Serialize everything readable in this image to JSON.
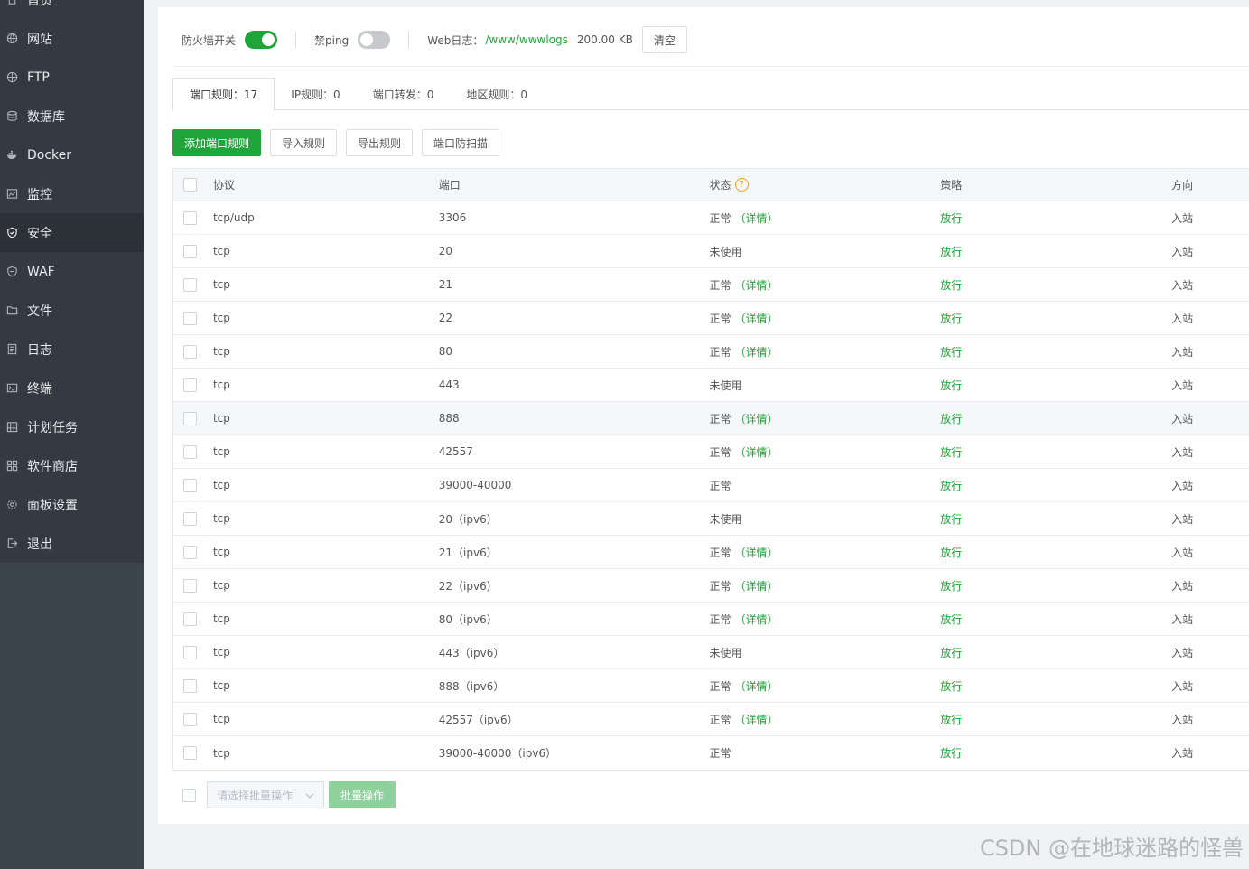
{
  "sidebar": {
    "items": [
      {
        "label": "首页",
        "icon": "home-icon",
        "active": false
      },
      {
        "label": "网站",
        "icon": "globe-icon",
        "active": false
      },
      {
        "label": "FTP",
        "icon": "ftp-icon",
        "active": false
      },
      {
        "label": "数据库",
        "icon": "database-icon",
        "active": false
      },
      {
        "label": "Docker",
        "icon": "docker-icon",
        "active": false
      },
      {
        "label": "监控",
        "icon": "monitor-icon",
        "active": false
      },
      {
        "label": "安全",
        "icon": "shield-check-icon",
        "active": true
      },
      {
        "label": "WAF",
        "icon": "waf-shield-icon",
        "active": false
      },
      {
        "label": "文件",
        "icon": "folder-icon",
        "active": false
      },
      {
        "label": "日志",
        "icon": "log-icon",
        "active": false
      },
      {
        "label": "终端",
        "icon": "terminal-icon",
        "active": false
      },
      {
        "label": "计划任务",
        "icon": "calendar-icon",
        "active": false
      },
      {
        "label": "软件商店",
        "icon": "grid-icon",
        "active": false
      },
      {
        "label": "面板设置",
        "icon": "gear-icon",
        "active": false
      },
      {
        "label": "退出",
        "icon": "logout-icon",
        "active": false
      }
    ]
  },
  "topbar": {
    "firewall_label": "防火墙开关",
    "firewall_on": true,
    "ping_label": "禁ping",
    "ping_on": false,
    "weblog_label": "Web日志：",
    "weblog_path": "/www/wwwlogs",
    "weblog_size": "200.00 KB",
    "clear_label": "清空"
  },
  "tabs": [
    {
      "label": "端口规则：17",
      "active": true
    },
    {
      "label": "IP规则：0",
      "active": false
    },
    {
      "label": "端口转发：0",
      "active": false
    },
    {
      "label": "地区规则：0",
      "active": false
    }
  ],
  "actions": {
    "add": "添加端口规则",
    "import": "导入规则",
    "export": "导出规则",
    "antiscan": "端口防扫描"
  },
  "table": {
    "headers": {
      "protocol": "协议",
      "port": "端口",
      "status": "状态",
      "policy": "策略",
      "direction": "方向"
    },
    "help_glyph": "?",
    "rows": [
      {
        "protocol": "tcp/udp",
        "port": "3306",
        "status": "正常",
        "detail": "（详情）",
        "policy": "放行",
        "direction": "入站"
      },
      {
        "protocol": "tcp",
        "port": "20",
        "status": "未使用",
        "detail": "",
        "policy": "放行",
        "direction": "入站"
      },
      {
        "protocol": "tcp",
        "port": "21",
        "status": "正常",
        "detail": "（详情）",
        "policy": "放行",
        "direction": "入站"
      },
      {
        "protocol": "tcp",
        "port": "22",
        "status": "正常",
        "detail": "（详情）",
        "policy": "放行",
        "direction": "入站"
      },
      {
        "protocol": "tcp",
        "port": "80",
        "status": "正常",
        "detail": "（详情）",
        "policy": "放行",
        "direction": "入站"
      },
      {
        "protocol": "tcp",
        "port": "443",
        "status": "未使用",
        "detail": "",
        "policy": "放行",
        "direction": "入站"
      },
      {
        "protocol": "tcp",
        "port": "888",
        "status": "正常",
        "detail": "（详情）",
        "policy": "放行",
        "direction": "入站"
      },
      {
        "protocol": "tcp",
        "port": "42557",
        "status": "正常",
        "detail": "（详情）",
        "policy": "放行",
        "direction": "入站"
      },
      {
        "protocol": "tcp",
        "port": "39000-40000",
        "status": "正常",
        "detail": "",
        "policy": "放行",
        "direction": "入站"
      },
      {
        "protocol": "tcp",
        "port": "20（ipv6）",
        "status": "未使用",
        "detail": "",
        "policy": "放行",
        "direction": "入站"
      },
      {
        "protocol": "tcp",
        "port": "21（ipv6）",
        "status": "正常",
        "detail": "（详情）",
        "policy": "放行",
        "direction": "入站"
      },
      {
        "protocol": "tcp",
        "port": "22（ipv6）",
        "status": "正常",
        "detail": "（详情）",
        "policy": "放行",
        "direction": "入站"
      },
      {
        "protocol": "tcp",
        "port": "80（ipv6）",
        "status": "正常",
        "detail": "（详情）",
        "policy": "放行",
        "direction": "入站"
      },
      {
        "protocol": "tcp",
        "port": "443（ipv6）",
        "status": "未使用",
        "detail": "",
        "policy": "放行",
        "direction": "入站"
      },
      {
        "protocol": "tcp",
        "port": "888（ipv6）",
        "status": "正常",
        "detail": "（详情）",
        "policy": "放行",
        "direction": "入站"
      },
      {
        "protocol": "tcp",
        "port": "42557（ipv6）",
        "status": "正常",
        "detail": "（详情）",
        "policy": "放行",
        "direction": "入站"
      },
      {
        "protocol": "tcp",
        "port": "39000-40000（ipv6）",
        "status": "正常",
        "detail": "",
        "policy": "放行",
        "direction": "入站"
      }
    ]
  },
  "batch": {
    "select_placeholder": "请选择批量操作",
    "button": "批量操作"
  },
  "watermark": "CSDN @在地球迷路的怪兽",
  "colors": {
    "accent": "#20a53a",
    "sidebar_bg": "#333a41",
    "sidebar_active": "#2b3137"
  }
}
